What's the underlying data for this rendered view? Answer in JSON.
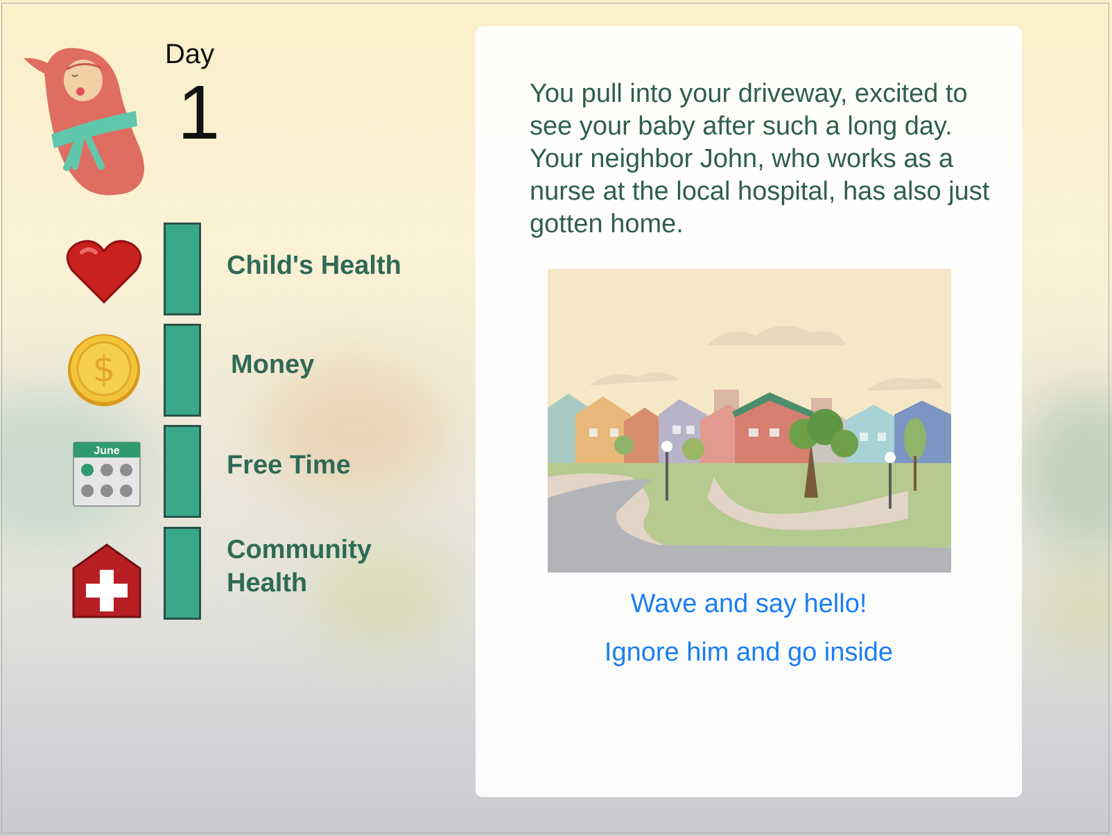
{
  "day": {
    "label": "Day",
    "number": "1"
  },
  "stats": [
    {
      "label": "Child's Health",
      "icon": "heart-icon"
    },
    {
      "label": "Money",
      "icon": "coin-icon"
    },
    {
      "label": "Free Time",
      "icon": "calendar-icon",
      "icon_text": "June"
    },
    {
      "label": "Community Health",
      "icon": "hospital-icon"
    }
  ],
  "story": {
    "text": "You pull into your driveway, excited to see your baby after such a long day. Your neighbor John, who works as a nurse at the local hospital, has also just gotten home."
  },
  "choices": [
    {
      "label": "Wave and say hello!"
    },
    {
      "label": "Ignore him and go inside"
    }
  ],
  "colors": {
    "bar_fill": "#39a889",
    "label_green": "#2f6a55",
    "choice_blue": "#1a7ef2",
    "baby_wrap": "#e06d62"
  }
}
